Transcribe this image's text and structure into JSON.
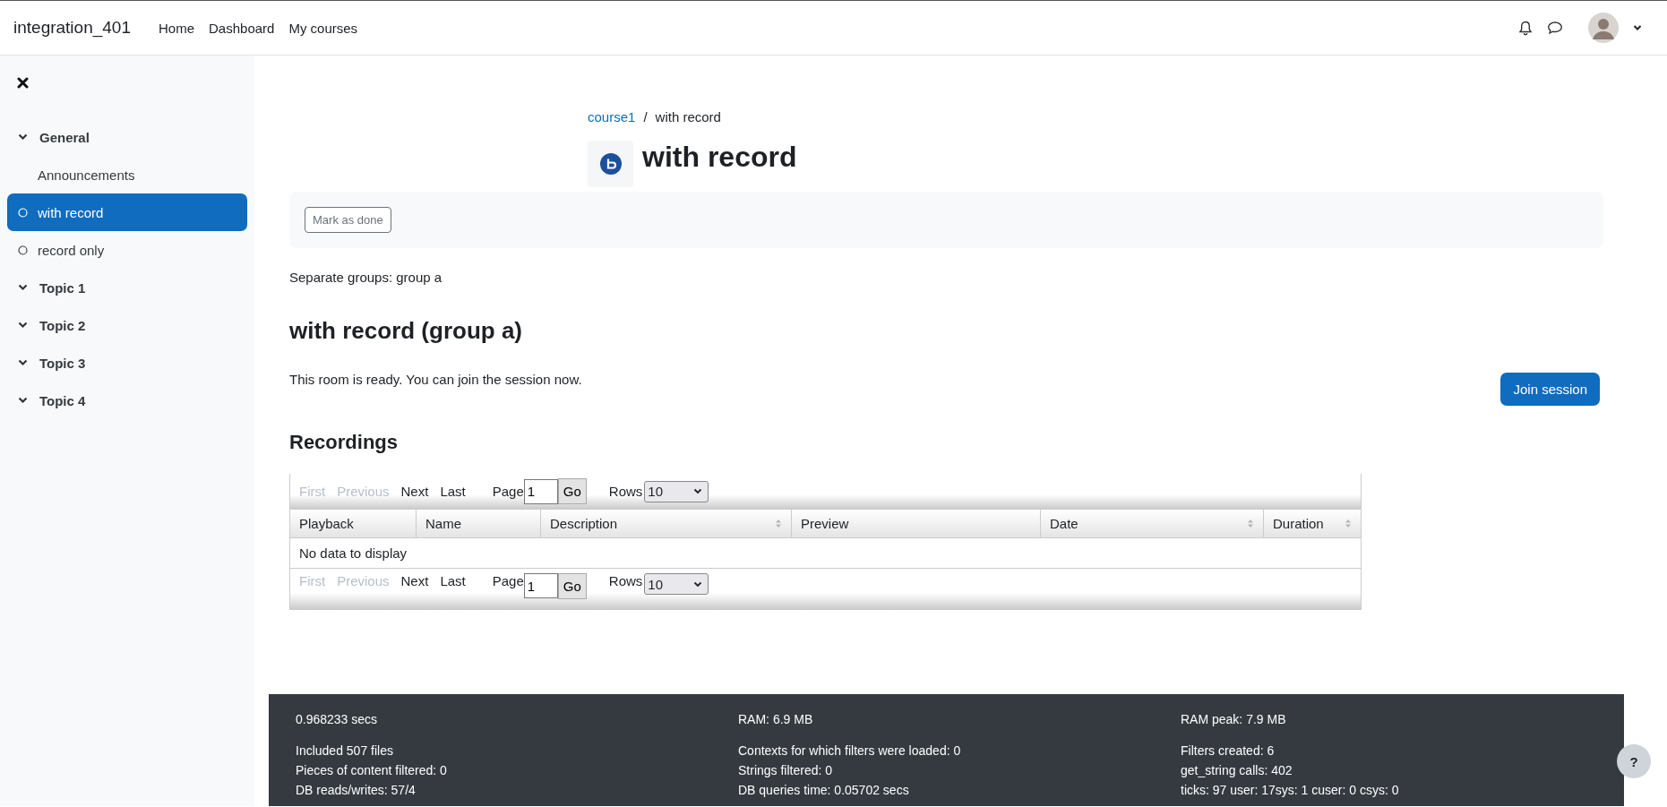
{
  "navbar": {
    "brand": "integration_401",
    "links": [
      {
        "label": "Home"
      },
      {
        "label": "Dashboard"
      },
      {
        "label": "My courses"
      }
    ]
  },
  "sidebar": {
    "sections": [
      {
        "label": "General",
        "children": [
          {
            "label": "Announcements",
            "kind": "plain",
            "selected": false
          },
          {
            "label": "with record",
            "kind": "tracked",
            "selected": true
          },
          {
            "label": "record only",
            "kind": "tracked",
            "selected": false
          }
        ]
      },
      {
        "label": "Topic 1"
      },
      {
        "label": "Topic 2"
      },
      {
        "label": "Topic 3"
      },
      {
        "label": "Topic 4"
      }
    ]
  },
  "breadcrumb": [
    {
      "label": "course1",
      "link": true
    },
    {
      "label": "with record",
      "link": false,
      "separator": "/"
    }
  ],
  "page_title": "with record",
  "mark_done_button": "Mark as done",
  "group_mode": "Separate groups: group a",
  "room_title": "with record (group a)",
  "room_status": "This room is ready. You can join the session now.",
  "join_button": "Join session",
  "recordings": {
    "title": "Recordings",
    "pager": [
      {
        "first": "First",
        "previous": "Previous",
        "next": "Next",
        "last": "Last",
        "page_label": "Page",
        "page_value": "1",
        "go": "Go",
        "rows_label": "Rows",
        "rows_value": "10"
      },
      {
        "first": "First",
        "previous": "Previous",
        "next": "Next",
        "last": "Last",
        "page_label": "Page",
        "page_value": "1",
        "go": "Go",
        "rows_label": "Rows",
        "rows_value": "10"
      }
    ],
    "columns": [
      {
        "label": "Playback",
        "sortable": false
      },
      {
        "label": "Name",
        "sortable": false
      },
      {
        "label": "Description",
        "sortable": true
      },
      {
        "label": "Preview",
        "sortable": false
      },
      {
        "label": "Date",
        "sortable": true
      },
      {
        "label": "Duration",
        "sortable": true
      }
    ],
    "empty_message": "No data to display"
  },
  "footer": {
    "summary": [
      "0.968233 secs",
      "RAM: 6.9 MB",
      "RAM peak: 7.9 MB"
    ],
    "details": [
      [
        "Included 507 files",
        "Pieces of content filtered: 0",
        "DB reads/writes: 57/4"
      ],
      [
        "Contexts for which filters were loaded: 0",
        "Strings filtered: 0",
        "DB queries time: 0.05702 secs"
      ],
      [
        "Filters created: 6",
        "get_string calls: 402",
        "ticks: 97 user: 17sys: 1 cuser: 0 csys: 0"
      ]
    ]
  },
  "help_button": "?"
}
